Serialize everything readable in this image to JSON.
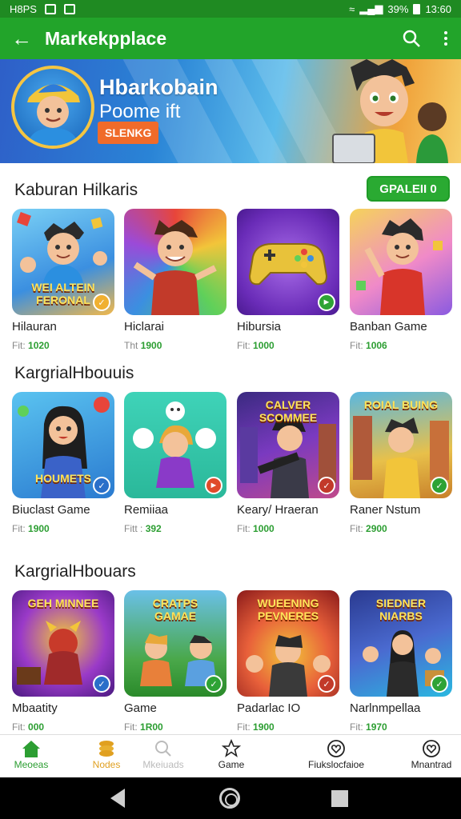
{
  "status_bar": {
    "carrier": "H8PS",
    "battery": "39%",
    "time": "13:60"
  },
  "app_bar": {
    "title": "Markekpplace"
  },
  "banner": {
    "title": "Hbarkobain",
    "subtitle": "Poome ift",
    "button": "SLENKG"
  },
  "sections": [
    {
      "title": "Kaburan Hilkaris",
      "action": "GPALEII 0",
      "items": [
        {
          "name": "Hilauran",
          "meta_label": "Fit:",
          "meta_value": "1020",
          "caption": "WEI ALTEIN FERONAL",
          "accent": "#f0b030"
        },
        {
          "name": "Hiclarai",
          "meta_label": "Tht",
          "meta_value": "1900",
          "caption": "",
          "accent": "#ffffff"
        },
        {
          "name": "Hibursia",
          "meta_label": "Fit:",
          "meta_value": "1000",
          "caption": "",
          "accent": "#2ea335"
        },
        {
          "name": "Banban Game",
          "meta_label": "Fit:",
          "meta_value": "1006",
          "caption": "",
          "accent": "#2ea335"
        }
      ]
    },
    {
      "title": "KargrialHbouuis",
      "items": [
        {
          "name": "Biuclast Game",
          "meta_label": "Fit:",
          "meta_value": "1900",
          "caption": "HOUMETS",
          "accent": "#2a6fc9"
        },
        {
          "name": "Remiiaa",
          "meta_label": "Fitt :",
          "meta_value": "392",
          "caption": "",
          "accent": "#e04a2a"
        },
        {
          "name": "Keary/ Hraeran",
          "meta_label": "Fit:",
          "meta_value": "1000",
          "caption": "CALVER SCOMMEE",
          "accent": "#c23a2a"
        },
        {
          "name": "Raner Nstum",
          "meta_label": "Fit:",
          "meta_value": "2900",
          "caption": "ROIAL BUING",
          "accent": "#2ea335"
        }
      ]
    },
    {
      "title": "KargrialHbouars",
      "items": [
        {
          "name": "Mbaatity",
          "meta_label": "Fit:",
          "meta_value": "000",
          "caption": "GEH MINNEE",
          "accent": "#2a6fc9"
        },
        {
          "name": "Game",
          "meta_label": "Fit:",
          "meta_value": "1R00",
          "caption": "CRATPS GAMAE",
          "accent": "#2ea335"
        },
        {
          "name": "Padarlac IO",
          "meta_label": "Fit:",
          "meta_value": "1900",
          "caption": "WUEENING PEVNERES",
          "accent": "#c23a2a"
        },
        {
          "name": "Narlnmpellaa",
          "meta_label": "Fit:",
          "meta_value": "1970",
          "caption": "SIEDNER NIARBS",
          "accent": "#2ea335"
        }
      ]
    }
  ],
  "bottom_nav": [
    {
      "label": "Meoeas",
      "icon": "home-icon",
      "color": "#2c9e32"
    },
    {
      "label": "Nodes",
      "icon": "coins-icon",
      "color": "#e0a020"
    },
    {
      "label": "Mkeiuads",
      "icon": "search-icon",
      "color": "#bbbbbb"
    },
    {
      "label": "Game",
      "icon": "star-icon",
      "color": "#222222"
    },
    {
      "label": "Fiukslocfaioe",
      "icon": "heart-icon",
      "color": "#222222"
    },
    {
      "label": "Mnantrad",
      "icon": "heart-icon",
      "color": "#222222"
    }
  ]
}
